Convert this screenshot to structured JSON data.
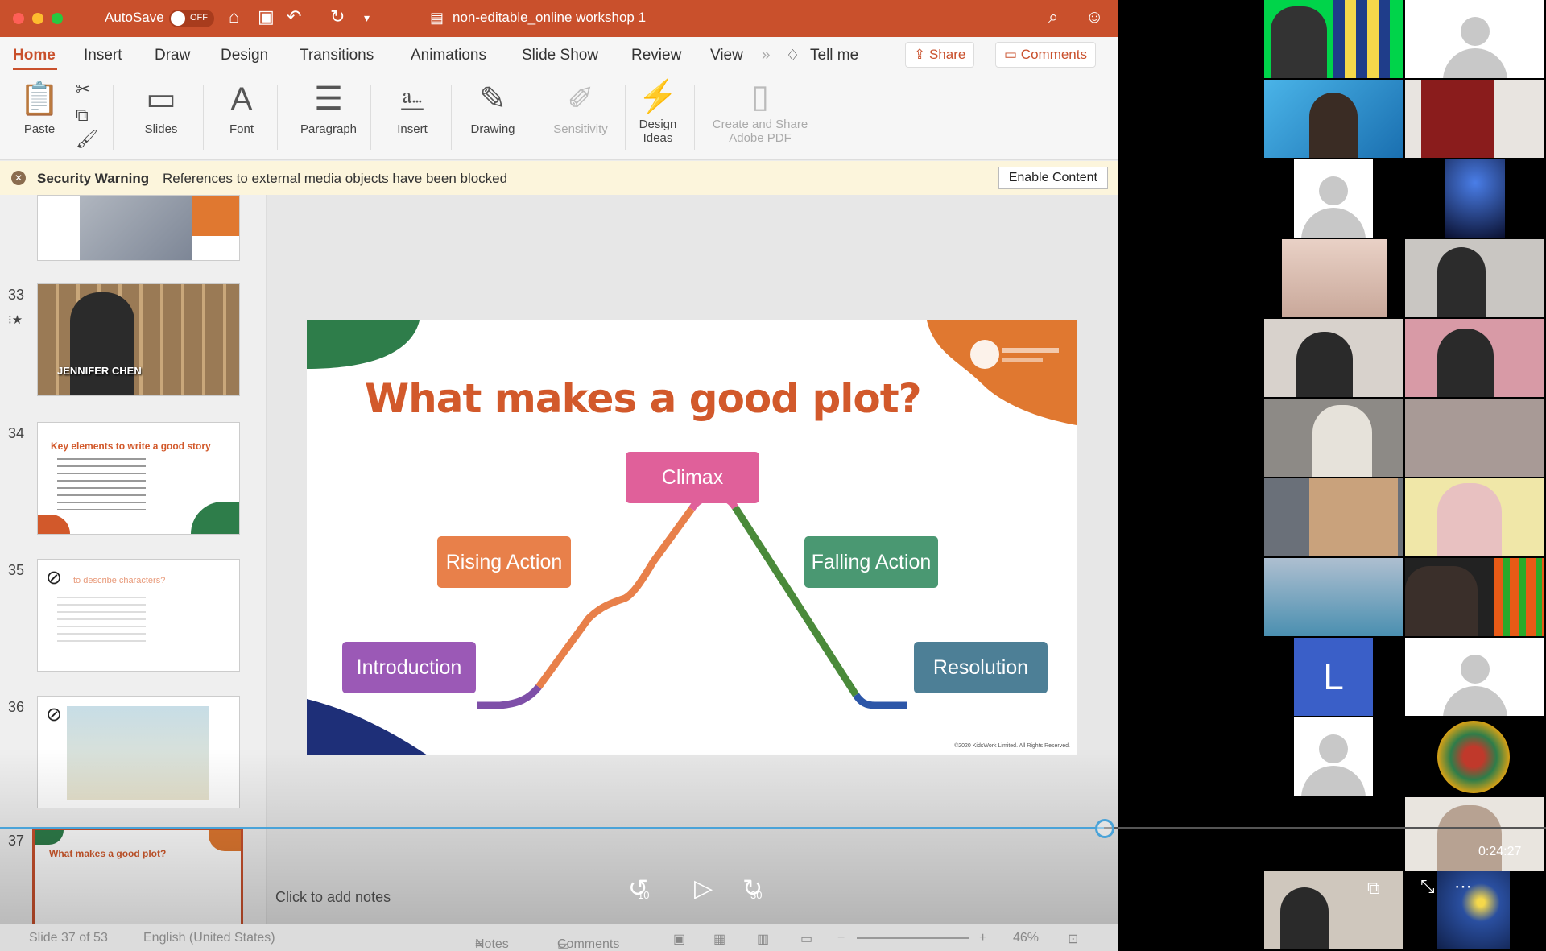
{
  "titlebar": {
    "autosave_label": "AutoSave",
    "autosave_state": "OFF",
    "doc_title": "non-editable_online workshop 1"
  },
  "menu": {
    "items": [
      "Home",
      "Insert",
      "Draw",
      "Design",
      "Transitions",
      "Animations",
      "Slide Show",
      "Review",
      "View"
    ],
    "tell_me": "Tell me",
    "share": "Share",
    "comments": "Comments"
  },
  "ribbon": {
    "paste": "Paste",
    "slides": "Slides",
    "font": "Font",
    "paragraph": "Paragraph",
    "insert": "Insert",
    "drawing": "Drawing",
    "sensitivity": "Sensitivity",
    "design_ideas": "Design Ideas",
    "create_share_pdf": "Create and Share Adobe PDF"
  },
  "security": {
    "title": "Security Warning",
    "message": "References to external media objects have been blocked",
    "button": "Enable Content"
  },
  "thumbnails": [
    {
      "number": "33",
      "caption": "JENNIFER CHEN"
    },
    {
      "number": "34",
      "title": "Key elements to write a good story"
    },
    {
      "number": "35",
      "title": "to describe characters?"
    },
    {
      "number": "36"
    },
    {
      "number": "37",
      "title": "What makes a good plot?"
    }
  ],
  "slide": {
    "title": "What makes a good plot?",
    "boxes": {
      "climax": "Climax",
      "rising": "Rising Action",
      "falling": "Falling Action",
      "intro": "Introduction",
      "resolution": "Resolution"
    },
    "copyright": "©2020 KidsWork Limited. All Rights Reserved."
  },
  "notes_placeholder": "Click to add notes",
  "player": {
    "rewind": "10",
    "forward": "30",
    "progress": 0.714,
    "time": "0:24:27"
  },
  "statusbar": {
    "slide_info": "Slide 37 of 53",
    "language": "English (United States)",
    "notes": "Notes",
    "comments": "Comments",
    "zoom": "46%"
  },
  "participants": {
    "initial_tile": "L"
  },
  "colors": {
    "accent": "#c9502c",
    "intro": "#9b59b6",
    "rising": "#e8804a",
    "climax": "#e0609a",
    "falling": "#4a9872",
    "resolution": "#4d7f96"
  }
}
